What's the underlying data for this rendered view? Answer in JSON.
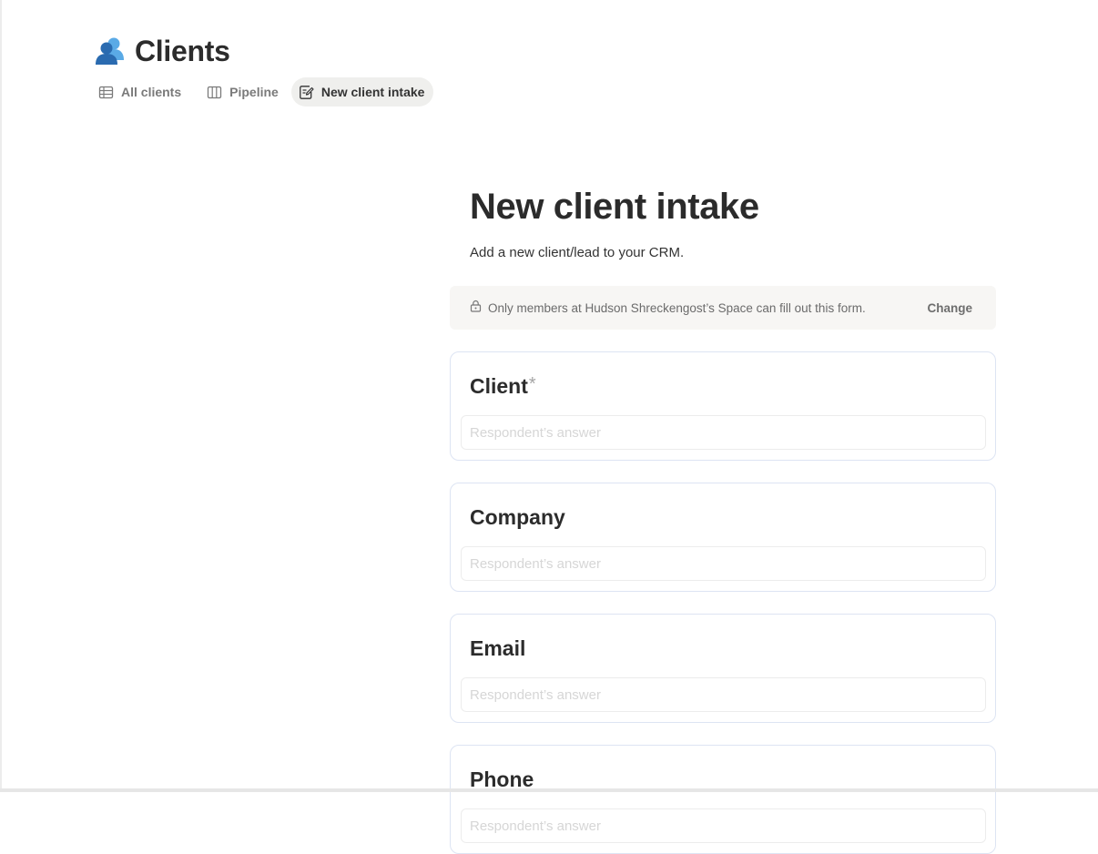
{
  "header": {
    "title": "Clients",
    "icon": "people-icon"
  },
  "tabs": [
    {
      "label": "All clients",
      "icon": "table-icon",
      "active": false
    },
    {
      "label": "Pipeline",
      "icon": "board-icon",
      "active": false
    },
    {
      "label": "New client intake",
      "icon": "form-icon",
      "active": true
    }
  ],
  "form": {
    "title": "New client intake",
    "description": "Add a new client/lead to your CRM.",
    "notice": {
      "text": "Only members at Hudson Shreckengost’s Space can fill out this form.",
      "action_label": "Change",
      "icon": "lock-icon"
    },
    "questions": [
      {
        "label": "Client",
        "required_mark": "*",
        "placeholder": "Respondent’s answer"
      },
      {
        "label": "Company",
        "required_mark": "",
        "placeholder": "Respondent’s answer"
      },
      {
        "label": "Email",
        "required_mark": "",
        "placeholder": "Respondent’s answer"
      },
      {
        "label": "Phone",
        "required_mark": "",
        "placeholder": "Respondent’s answer"
      }
    ]
  },
  "colors": {
    "accent_blue": "#4a9fe0",
    "dark_blue": "#2b6fb5",
    "card_border": "#dde4f3",
    "notice_bg": "#f7f6f4",
    "active_tab_bg": "#efefed"
  }
}
